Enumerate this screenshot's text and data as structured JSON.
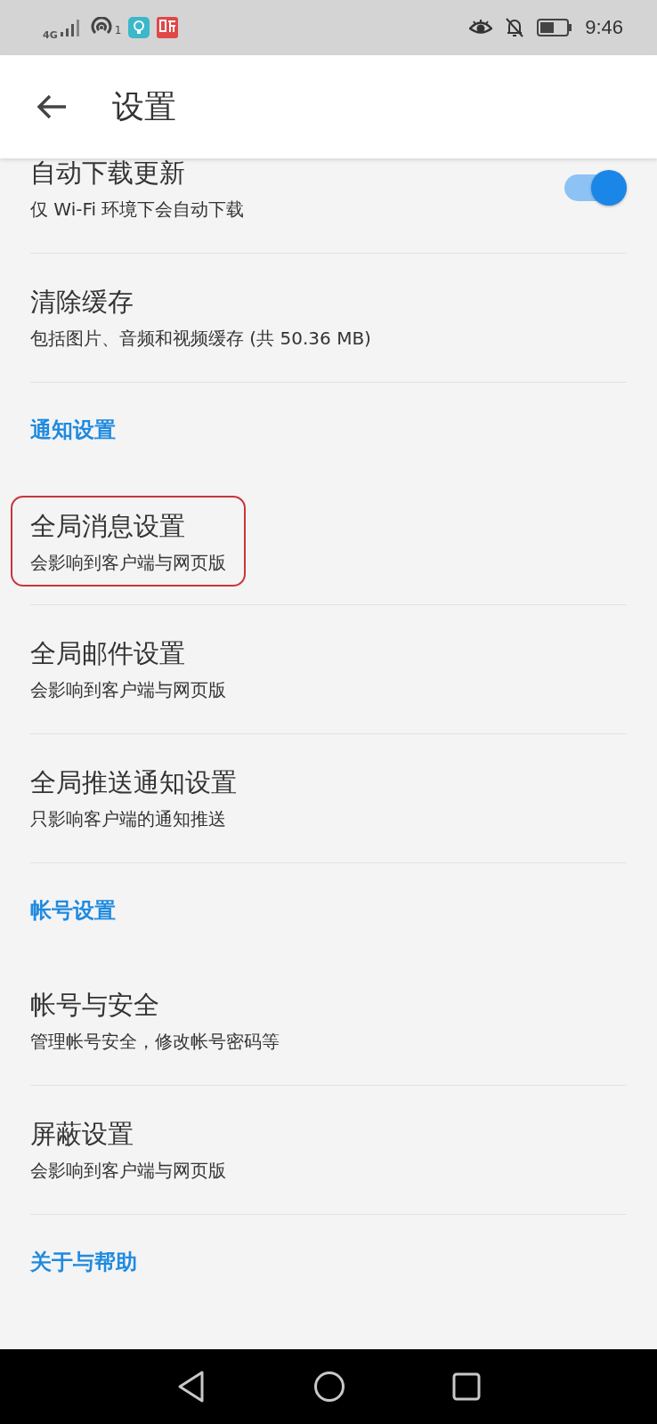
{
  "status_bar": {
    "network": "4G",
    "hotspot_count": "1",
    "time": "9:46"
  },
  "header": {
    "title": "设置"
  },
  "rows": [
    {
      "kind": "switch",
      "title": "自动下载更新",
      "subtitle": "仅 Wi-Fi 环境下会自动下载",
      "on": true
    },
    {
      "kind": "item",
      "title": "清除缓存",
      "subtitle": "包括图片、音频和视频缓存 (共 50.36 MB)",
      "highlighted": false
    },
    {
      "kind": "section",
      "title": "通知设置"
    },
    {
      "kind": "item",
      "title": "全局消息设置",
      "subtitle": "会影响到客户端与网页版",
      "highlighted": true
    },
    {
      "kind": "item",
      "title": "全局邮件设置",
      "subtitle": "会影响到客户端与网页版",
      "highlighted": false
    },
    {
      "kind": "item",
      "title": "全局推送通知设置",
      "subtitle": "只影响客户端的通知推送",
      "highlighted": false
    },
    {
      "kind": "section",
      "title": "帐号设置"
    },
    {
      "kind": "item",
      "title": "帐号与安全",
      "subtitle": "管理帐号安全，修改帐号密码等",
      "highlighted": false
    },
    {
      "kind": "item",
      "title": "屏蔽设置",
      "subtitle": "会影响到客户端与网页版",
      "highlighted": false
    },
    {
      "kind": "section",
      "title": "关于与帮助"
    }
  ]
}
